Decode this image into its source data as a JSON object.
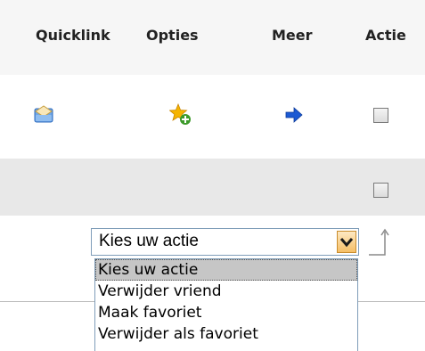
{
  "table": {
    "headers": {
      "quicklink": "Quicklink",
      "opties": "Opties",
      "meer": "Meer",
      "actie": "Actie"
    },
    "rows": [
      {
        "quicklink_icon": "envelope-icon",
        "opties_icon": "star-add-icon",
        "meer_icon": "arrow-right-icon",
        "actie_checked": false
      },
      {
        "actie_checked": false
      }
    ]
  },
  "action": {
    "select": {
      "value": "Kies uw actie",
      "options": [
        "Kies uw actie",
        "Verwijder vriend",
        "Maak favoriet",
        "Verwijder als favoriet"
      ],
      "selected_index": 0
    },
    "apply_icon": "return-arrow-icon"
  },
  "colors": {
    "header_bg": "#f6f6f6",
    "alt_row_bg": "#e8e8e8",
    "select_border": "#7f9db9",
    "arrow_button": "#f6bf66",
    "arrow_blue": "#1c5ad3",
    "star_gold": "#f5b400",
    "plus_green": "#3c9a2a"
  }
}
